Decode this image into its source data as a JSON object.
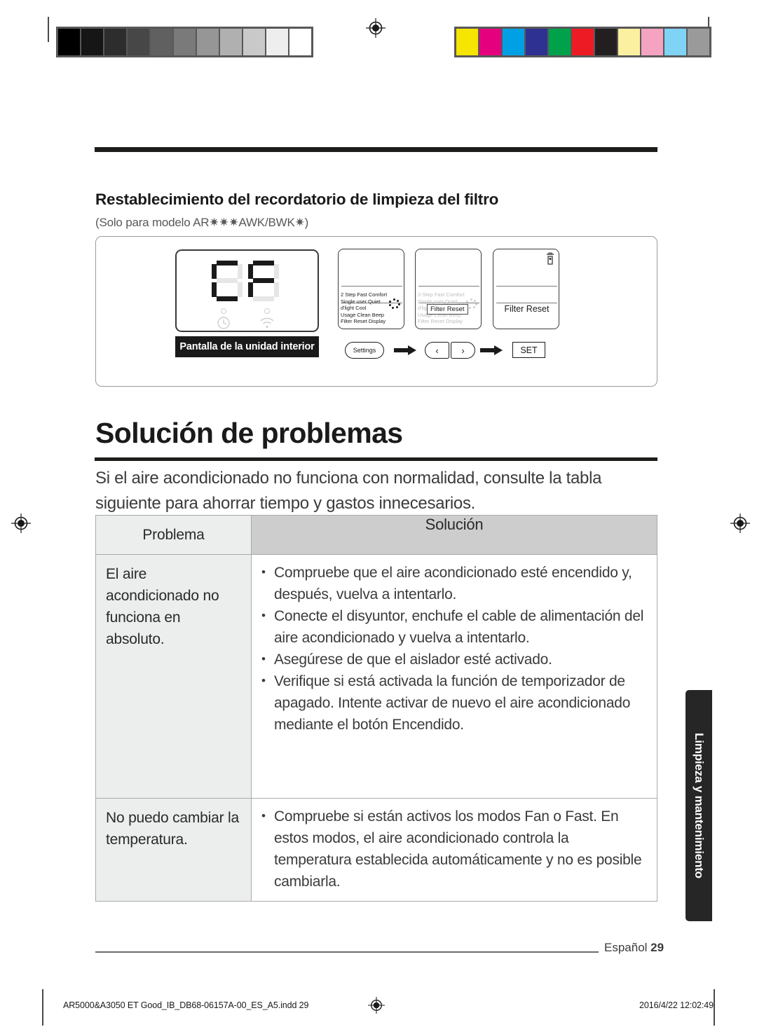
{
  "calibration": {
    "gray_swatches": [
      "#000000",
      "#161616",
      "#2d2d2d",
      "#474747",
      "#606060",
      "#7a7a7a",
      "#969696",
      "#b0b0b0",
      "#c9c9c9",
      "#eeeeee",
      "#ffffff"
    ],
    "color_swatches": [
      "#f5e500",
      "#e5007d",
      "#00a0e4",
      "#2e3192",
      "#00a14b",
      "#ed1c24",
      "#231f20",
      "#faf0a0",
      "#f4a4c0",
      "#7fd3f5",
      "#9a9a9a"
    ],
    "registration_icon": "registration-target-icon"
  },
  "section": {
    "title": "Restablecimiento del recordatorio de limpieza del filtro",
    "subtitle": "(Solo para modelo AR✷✷✷AWK/BWK✷)"
  },
  "figure": {
    "display": {
      "digits": "CF",
      "label": "Pantalla de la unidad interior",
      "indicators": [
        "timer-icon",
        "wifi-icon"
      ]
    },
    "panels": [
      {
        "id": "panel-1",
        "state": "active",
        "menu_lines": [
          "2 Step  Fast  Comfort",
          "Single user  Quiet",
          "d'light Cool",
          "Usage   Clean   Beep",
          "Filter Reset     Display"
        ]
      },
      {
        "id": "panel-2",
        "state": "dimmed",
        "menu_lines": [
          "2-Step  Fast  Comfort",
          "Single user  Quiet",
          "d'light Cool",
          "Usage   Clean   Beep",
          "Filter Reset     Display"
        ],
        "callout": "Filter Reset"
      },
      {
        "id": "panel-3",
        "state": "selected",
        "selected_label": "Filter Reset",
        "corner_icon": "remote-signal-icon"
      }
    ],
    "flow": {
      "settings_label": "Settings",
      "prev_label": "‹",
      "next_label": "›",
      "set_label": "SET",
      "arrow_icon": "right-arrow-icon"
    }
  },
  "chapter": {
    "title": "Solución de problemas",
    "intro": "Si el aire acondicionado no funciona con normalidad, consulte la tabla siguiente para ahorrar tiempo y gastos innecesarios."
  },
  "table": {
    "headers": [
      "Problema",
      "Solución"
    ],
    "rows": [
      {
        "problem": "El aire acondicionado no funciona en absoluto.",
        "solutions": [
          "Compruebe que el aire acondicionado esté encendido y, después, vuelva a intentarlo.",
          "Conecte el disyuntor, enchufe el cable de alimentación del aire acondicionado y vuelva a intentarlo.",
          "Asegúrese de que el aislador esté activado.",
          "Verifique si está activada la función de temporizador de apagado. Intente activar de nuevo el aire acondicionado mediante el botón Encendido."
        ]
      },
      {
        "problem": "No puedo cambiar la temperatura.",
        "solutions": [
          "Compruebe si están activos los modos Fan o Fast. En estos modos, el aire acondicionado controla la temperatura establecida automáticamente y no es posible cambiarla."
        ]
      }
    ]
  },
  "side_tab": {
    "label": "Limpieza y mantenimiento"
  },
  "footer": {
    "language": "Español",
    "page_number": "29",
    "file_name": "AR5000&A3050 ET Good_IB_DB68-06157A-00_ES_A5.indd   29",
    "timestamp": "2016/4/22   12:02:49",
    "registration_icon": "registration-target-icon"
  }
}
